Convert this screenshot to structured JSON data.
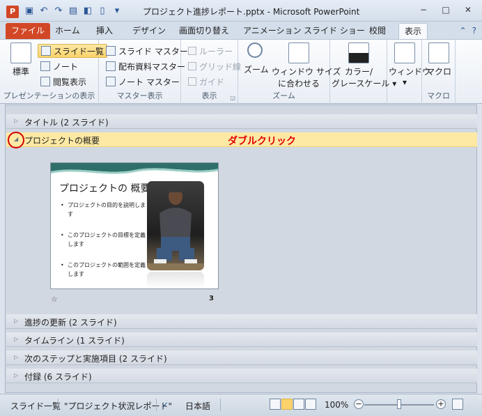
{
  "window": {
    "app_icon": "P",
    "title": "プロジェクト進捗レポート.pptx - Microsoft PowerPoint",
    "min_label": "−",
    "max_label": "□",
    "close_label": "✕"
  },
  "qat": [
    "save-icon",
    "undo-icon",
    "redo-icon",
    "open-icon",
    "print-preview-icon",
    "new-icon",
    "customize-icon"
  ],
  "tabs": [
    "ファイル",
    "ホーム",
    "挿入",
    "デザイン",
    "画面切り替え",
    "アニメーション",
    "スライド ショー",
    "校閲",
    "表示"
  ],
  "tabs_right": [
    "⌃",
    "?"
  ],
  "ribbon": {
    "presentation_views": {
      "normal": "標準",
      "slide_sorter": "スライド一覧",
      "notes": "ノート",
      "reading_view": "閲覧表示",
      "label": "プレゼンテーションの表示"
    },
    "master_views": {
      "slide_master": "スライド マスター",
      "handout_master": "配布資料マスター",
      "notes_master": "ノート マスター",
      "label": "マスター表示"
    },
    "show": {
      "ruler": "ルーラー",
      "gridlines": "グリッド線",
      "guides": "ガイド",
      "label": "表示"
    },
    "zoom": {
      "zoom": "ズーム",
      "fit_line1": "ウィンドウ サイズ",
      "fit_line2": "に合わせる",
      "label": "ズーム"
    },
    "color": {
      "line1": "カラー/",
      "line2": "グレースケール"
    },
    "window": {
      "label_btn": "ウィンドウ"
    },
    "macros": {
      "macro_btn": "マクロ",
      "label": "マクロ"
    }
  },
  "sections": [
    {
      "label": "タイトル (2 スライド)",
      "open": false
    },
    {
      "label": "プロジェクトの概要",
      "open": true
    },
    {
      "label": "進捗の更新 (2 スライド)",
      "open": false
    },
    {
      "label": "タイムライン (1 スライド)",
      "open": false
    },
    {
      "label": "次のステップと実施項目 (2 スライド)",
      "open": false
    },
    {
      "label": "付録 (6 スライド)",
      "open": false
    }
  ],
  "annotation": "ダブルクリック",
  "slide": {
    "title": "プロジェクトの 概要",
    "bullets": [
      "プロジェクトの目的を説明します",
      "このプロジェクトの目標を定義します",
      "このプロジェクトの範囲を定義します"
    ],
    "number": "3",
    "star": "☆"
  },
  "status": {
    "view": "スライド一覧",
    "theme": "\"プロジェクト状況レポート\"",
    "language": "日本語",
    "zoom": "100%",
    "zoom_level": 100
  }
}
